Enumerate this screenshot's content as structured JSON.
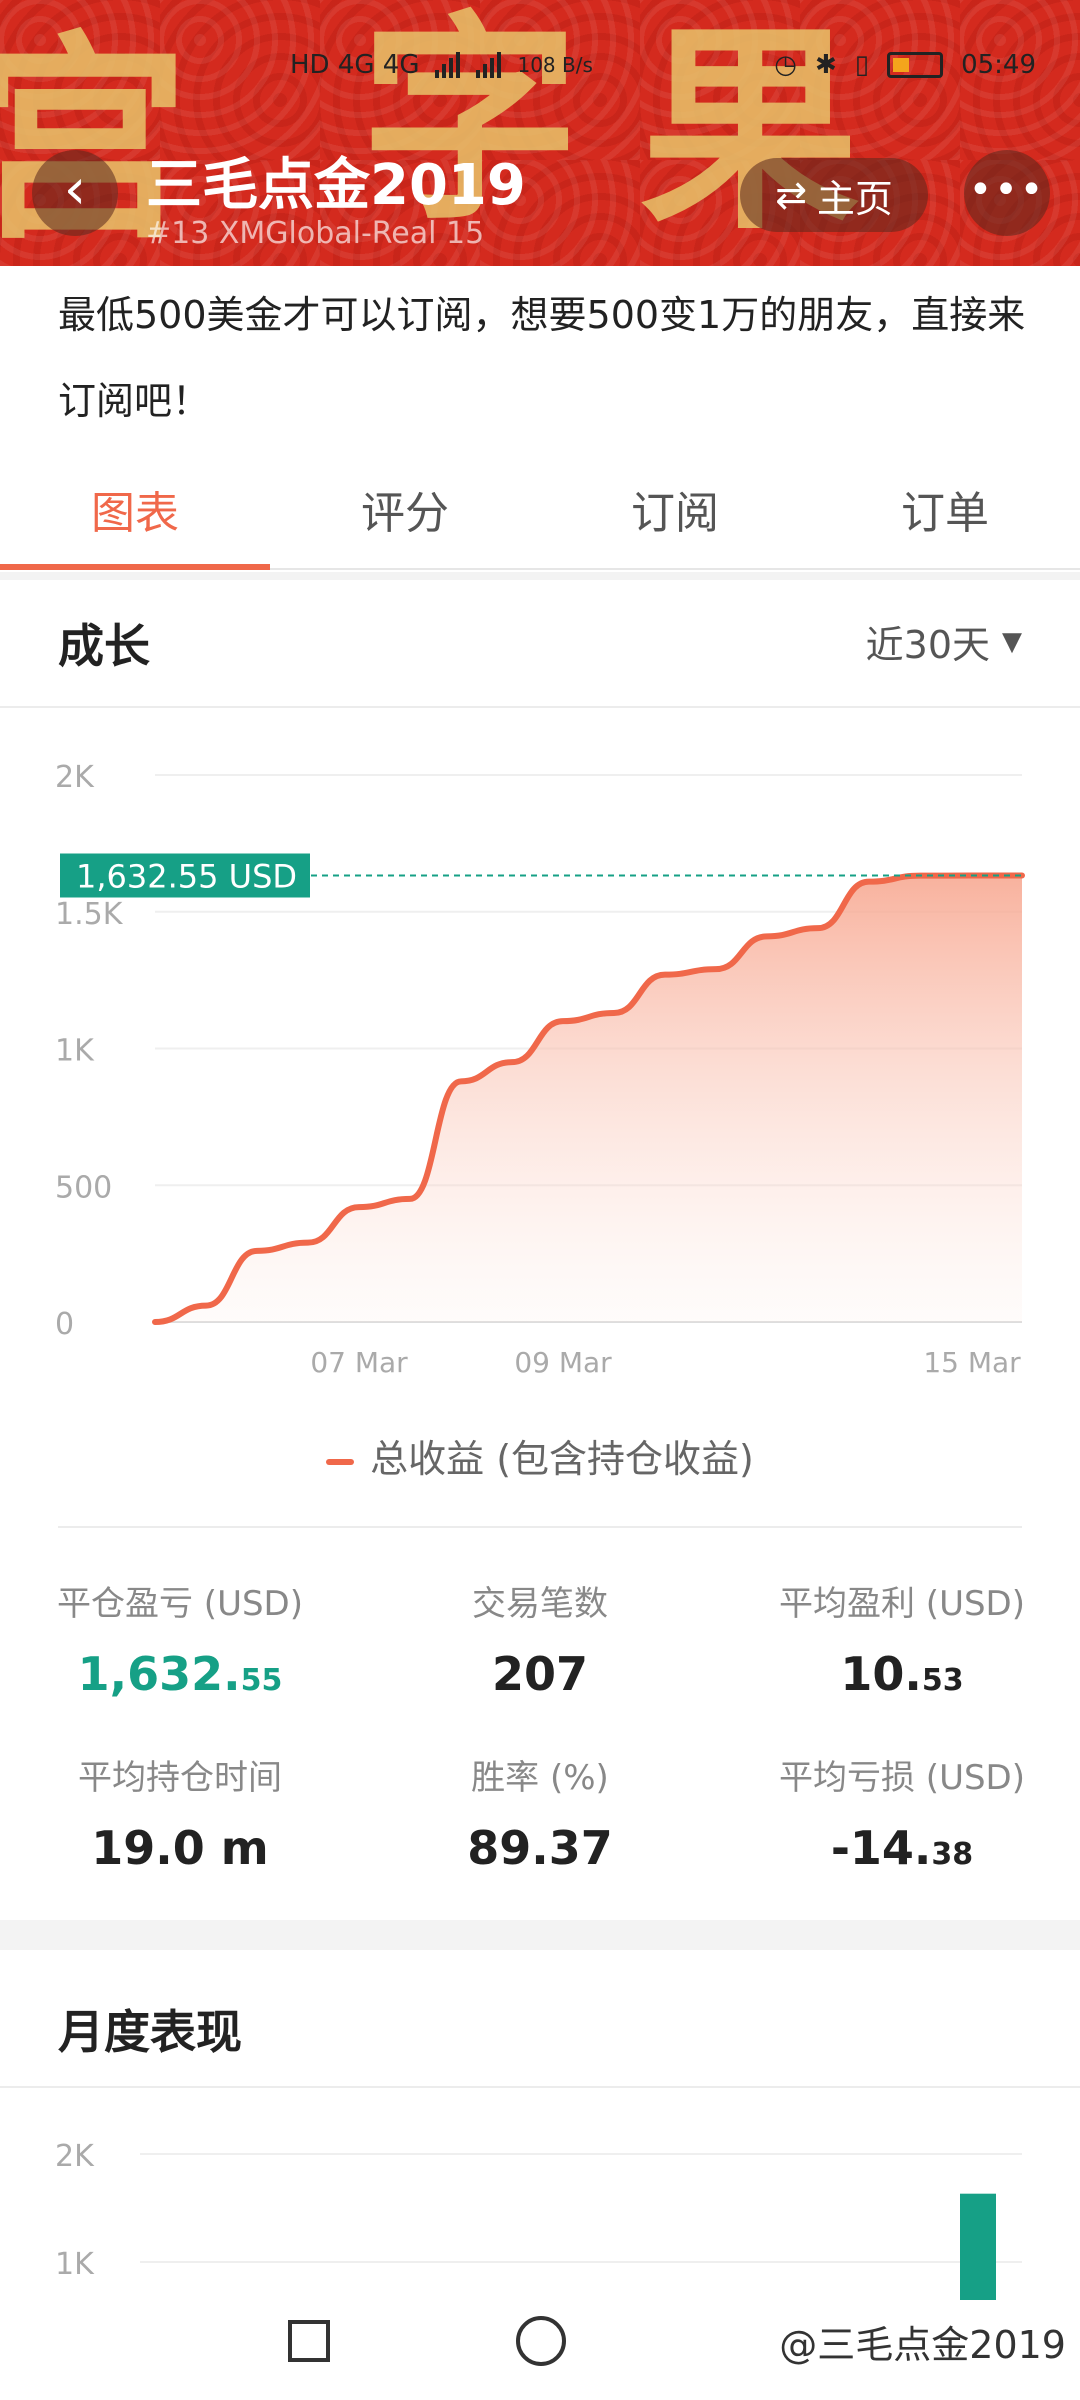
{
  "status_bar": {
    "network_left": "HD 4G 4G",
    "speed": "108 B/s",
    "time": "05:49"
  },
  "header": {
    "back_icon": "chevron-left-icon",
    "title": "三毛点金2019",
    "subtitle": "#13   XMGlobal-Real 15",
    "home_label": "主页",
    "home_icon": "swap-icon",
    "more_icon": "more-dots-icon",
    "banner_color": "#d42a1e",
    "banner_chars": [
      "宫",
      "字",
      "果"
    ]
  },
  "description": "最低500美金才可以订阅，想要500变1万的朋友，直接来订阅吧！",
  "tabs": [
    {
      "label": "图表",
      "active": true
    },
    {
      "label": "评分",
      "active": false
    },
    {
      "label": "订阅",
      "active": false
    },
    {
      "label": "订单",
      "active": false
    }
  ],
  "growth": {
    "title": "成长",
    "range_label": "近30天"
  },
  "chart_data": {
    "type": "area",
    "x": [
      "05 Mar",
      "05 Mar",
      "06 Mar",
      "06 Mar",
      "07 Mar",
      "07 Mar",
      "08 Mar",
      "08 Mar",
      "09 Mar",
      "09 Mar",
      "10 Mar",
      "10 Mar",
      "11 Mar",
      "12 Mar",
      "13 Mar",
      "14 Mar",
      "15 Mar",
      "15 Mar"
    ],
    "y": [
      0,
      60,
      260,
      290,
      420,
      450,
      880,
      950,
      1100,
      1130,
      1270,
      1290,
      1410,
      1440,
      1610,
      1632,
      1632.55,
      1632.55
    ],
    "x_tick_labels": [
      "07 Mar",
      "09 Mar",
      "15 Mar"
    ],
    "y_tick_labels": [
      "0",
      "500",
      "1K",
      "1.5K",
      "2K"
    ],
    "ylim": [
      0,
      2000
    ],
    "current_value_label": "1,632.55 USD",
    "current_value": 1632.55,
    "legend": "总收益 (包含持仓收益)",
    "line_color": "#f0684a",
    "marker_color": "#16a086",
    "grid": true
  },
  "stats": [
    {
      "label": "平仓盈亏 (USD)",
      "int": "1,632.",
      "dec": "55",
      "color": "green"
    },
    {
      "label": "交易笔数",
      "int": "207",
      "dec": "",
      "color": "dark"
    },
    {
      "label": "平均盈利 (USD)",
      "int": "10.",
      "dec": "53",
      "color": "dark"
    },
    {
      "label": "平均持仓时间",
      "int": "19.0 m",
      "dec": "",
      "color": "dark"
    },
    {
      "label": "胜率 (%)",
      "int": "89.37",
      "dec": "",
      "color": "dark"
    },
    {
      "label": "平均亏损 (USD)",
      "int": "-14.",
      "dec": "38",
      "color": "dark"
    }
  ],
  "monthly": {
    "title": "月度表现",
    "y_tick_labels": [
      "1K",
      "2K"
    ],
    "bar_color": "#16a086"
  },
  "monthly_chart_data": {
    "type": "bar",
    "values": [
      1632.55
    ],
    "ylim": [
      0,
      2000
    ]
  },
  "navbar": {
    "watermark": "@三毛点金2019"
  }
}
